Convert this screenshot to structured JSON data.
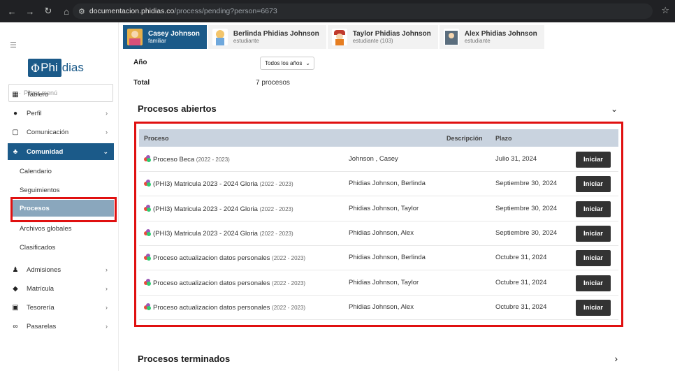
{
  "browser": {
    "url_domain": "documentacion.phidias.co",
    "url_path": "/process/pending?person=6673"
  },
  "sidebar": {
    "logo_text": "Phidias",
    "logo_symbol": "Φ",
    "filter_placeholder": "Filtrar menú",
    "items": [
      {
        "label": "Tablero",
        "icon": "dashboard-icon"
      },
      {
        "label": "Perfil",
        "icon": "person-icon"
      },
      {
        "label": "Comunicación",
        "icon": "chat-icon"
      },
      {
        "label": "Comunidad",
        "icon": "community-icon"
      },
      {
        "label": "Admisiones",
        "icon": "admissions-icon"
      },
      {
        "label": "Matrícula",
        "icon": "graduation-cap-icon"
      },
      {
        "label": "Tesorería",
        "icon": "money-icon"
      },
      {
        "label": "Pasarelas",
        "icon": "link-icon"
      }
    ],
    "subitems": [
      "Calendario",
      "Seguimientos",
      "Procesos",
      "Archivos globales",
      "Clasificados"
    ]
  },
  "tabs": [
    {
      "name": "Casey Johnson",
      "role": "familiar"
    },
    {
      "name": "Berlinda Phidias Johnson",
      "role": "estudiante"
    },
    {
      "name": "Taylor Phidias Johnson",
      "role": "estudiante (103)"
    },
    {
      "name": "Alex Phidias Johnson",
      "role": "estudiante"
    }
  ],
  "filters": {
    "year_label": "Año",
    "year_value": "Todos los años",
    "total_label": "Total",
    "total_value": "7 procesos"
  },
  "open_section": {
    "title": "Procesos abiertos",
    "columns": [
      "Proceso",
      "Descripción",
      "Plazo"
    ],
    "button_label": "Iniciar",
    "rows": [
      {
        "process": "Proceso Beca",
        "years": "(2022 - 2023)",
        "person": "Johnson , Casey",
        "deadline": "Julio 31, 2024"
      },
      {
        "process": "(PHI3) Matricula 2023 - 2024 Gloria",
        "years": "(2022 - 2023)",
        "person": "Phidias Johnson, Berlinda",
        "deadline": "Septiembre 30, 2024"
      },
      {
        "process": "(PHI3) Matricula 2023 - 2024 Gloria",
        "years": "(2022 - 2023)",
        "person": "Phidias Johnson, Taylor",
        "deadline": "Septiembre 30, 2024"
      },
      {
        "process": "(PHI3) Matricula 2023 - 2024 Gloria",
        "years": "(2022 - 2023)",
        "person": "Phidias Johnson, Alex",
        "deadline": "Septiembre 30, 2024"
      },
      {
        "process": "Proceso actualizacion datos personales",
        "years": "(2022 - 2023)",
        "person": "Phidias Johnson, Berlinda",
        "deadline": "Octubre 31, 2024"
      },
      {
        "process": "Proceso actualizacion datos personales",
        "years": "(2022 - 2023)",
        "person": "Phidias Johnson, Taylor",
        "deadline": "Octubre 31, 2024"
      },
      {
        "process": "Proceso actualizacion datos personales",
        "years": "(2022 - 2023)",
        "person": "Phidias Johnson, Alex",
        "deadline": "Octubre 31, 2024"
      }
    ]
  },
  "closed_section": {
    "title": "Procesos terminados"
  },
  "colors": {
    "primary": "#1b5a89",
    "selected_subitem": "#8aa7bd",
    "highlight": "#e01010",
    "table_header": "#c9d3df",
    "button": "#333333"
  }
}
